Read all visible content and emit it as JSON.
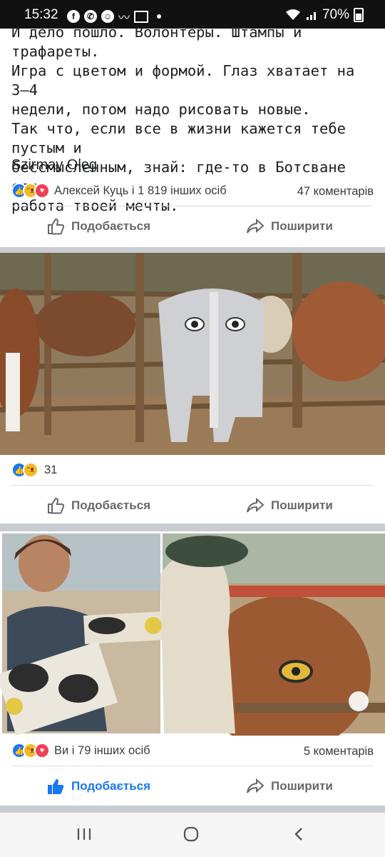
{
  "status": {
    "time": "15:32",
    "battery": "70%",
    "icons": [
      "facebook-icon",
      "whatsapp-icon",
      "messenger-icon",
      "mustache-icon",
      "gallery-icon"
    ]
  },
  "post1": {
    "text": "И дело пошло. Волонтеры. Штампы и трафареты.\nИгра с цветом и формой. Глаз хватает на 3–4\nнедели, потом надо рисовать новые.\nТак что, если все в жизни кажется тебе пустым и\nбессмысленным, знай: где-то в Ботсване есть\nработа твоей мечты.",
    "author": "Szirmay Oleg",
    "reactions_text": "Алексей Куць і 1 819 інших осіб",
    "comments": "47 коментарів",
    "like_label": "Подобається",
    "share_label": "Поширити"
  },
  "photo1": {
    "alt": "cow with painted eyes on its rump in a wooden kraal"
  },
  "post2": {
    "reactions_text": "31",
    "like_label": "Подобається",
    "share_label": "Поширити"
  },
  "photo2": {
    "alt": "volunteer holding eye stencils; painting eyes on a cow"
  },
  "post3": {
    "reactions_text": "Ви і 79 інших осіб",
    "comments": "5 коментарів",
    "like_label": "Подобається",
    "share_label": "Поширити"
  },
  "colors": {
    "accent": "#1877f2",
    "muted": "#65676b",
    "separator": "#c9ccd1"
  }
}
